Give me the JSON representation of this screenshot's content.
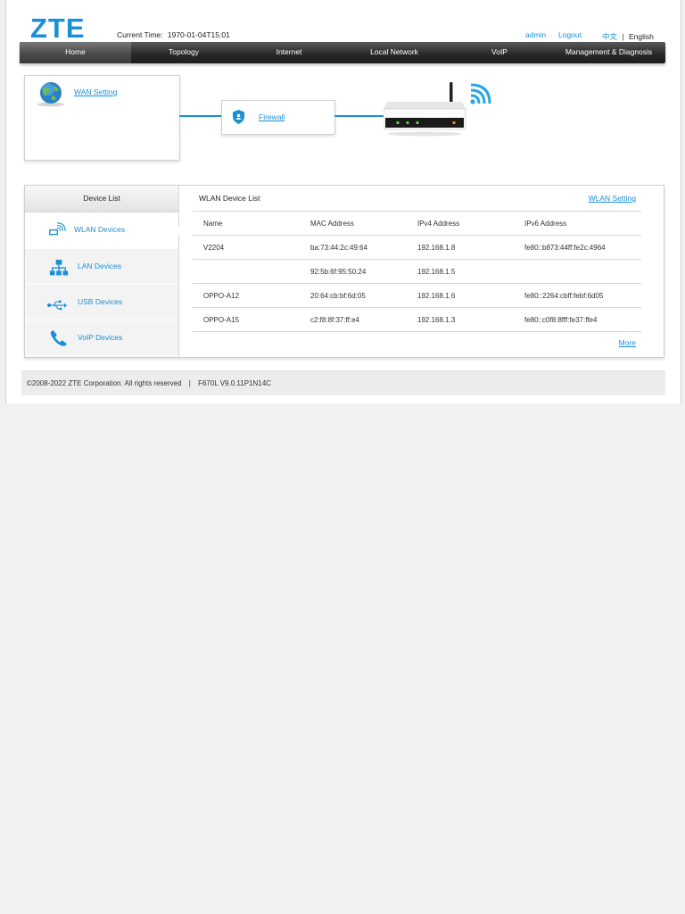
{
  "header": {
    "logo": "ZTE",
    "current_time_label": "Current Time:",
    "current_time_value": "1970-01-04T15:01",
    "user": "admin",
    "logout": "Logout",
    "lang_zh": "中文",
    "lang_sep": "|",
    "lang_en": "English"
  },
  "nav": {
    "tabs": [
      "Home",
      "Topology",
      "Internet",
      "Local Network",
      "VoIP",
      "Management & Diagnosis"
    ]
  },
  "topology": {
    "wan_setting": "WAN Setting",
    "firewall": "Firewall"
  },
  "devices": {
    "sidebar_title": "Device List",
    "items": [
      "WLAN Devices",
      "LAN Devices",
      "USB Devices",
      "VoIP Devices"
    ],
    "list_title": "WLAN Device List",
    "settings_link": "WLAN Setting",
    "columns": [
      "Name",
      "MAC Address",
      "IPv4 Address",
      "IPv6 Address"
    ],
    "rows": [
      [
        "V2204",
        "ba:73:44:2c:49:64",
        "192.168.1.8",
        "fe80::b873:44ff:fe2c:4964"
      ],
      [
        "",
        "92:5b:6f:95:50:24",
        "192.168.1.5",
        ""
      ],
      [
        "OPPO-A12",
        "20:64:cb:bf:6d:05",
        "192.168.1.6",
        "fe80::2264:cbff:febf:6d05"
      ],
      [
        "OPPO-A15",
        "c2:f8:8f:37:ff:e4",
        "192.168.1.3",
        "fe80::c0f8:8fff:fe37:ffe4"
      ]
    ],
    "more": "More"
  },
  "footer": {
    "copyright": "©2008-2022 ZTE Corporation. All rights reserved",
    "sep": "|",
    "version": "F670L V9.0.11P1N14C"
  },
  "colors": {
    "accent": "#1a8fd6",
    "nav_bg": "#2a2a2a",
    "page_bg": "#f1f1f1"
  },
  "icons": {
    "wan": "globe-icon",
    "firewall": "shield-icon",
    "router": "router-icon",
    "wifi": "wifi-signal-icon",
    "wlan": "wlan-icon",
    "lan": "lan-network-icon",
    "usb": "usb-icon",
    "voip": "phone-icon"
  }
}
